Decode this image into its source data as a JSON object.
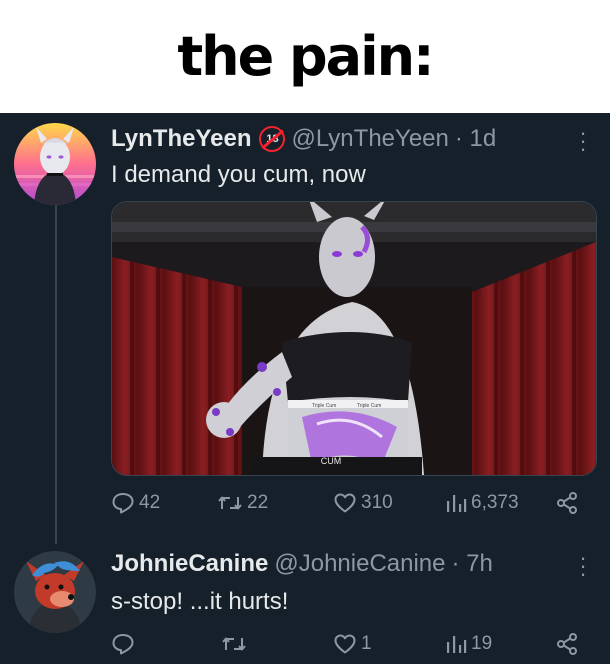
{
  "caption": {
    "text": "the pain:"
  },
  "tweets": [
    {
      "display_name": "LynTheYeen",
      "age_badge": "18",
      "handle": "@LynTheYeen",
      "time": "· 1d",
      "text": "I demand you cum, now",
      "media": {
        "label_words": [
          "Triple Cum",
          "Triple Cum",
          "CUM"
        ]
      },
      "metrics": {
        "replies": "42",
        "reposts": "22",
        "likes": "310",
        "views": "6,373"
      }
    },
    {
      "display_name": "JohnieCanine",
      "handle": "@JohnieCanine",
      "time": "· 7h",
      "text": "s-stop! ...it hurts!",
      "metrics": {
        "replies": "",
        "reposts": "",
        "likes": "1",
        "views": "19"
      }
    }
  ],
  "icons": {
    "reply": "speech-bubble-icon",
    "repost": "repost-arrows-icon",
    "like": "heart-icon",
    "views": "bar-chart-icon",
    "share": "share-icon",
    "more": "vertical-ellipsis-icon"
  },
  "colors": {
    "background": "#15202b",
    "caption_bg": "#ffffff",
    "text_primary": "#e7e9ea",
    "text_secondary": "#8b98a5",
    "thread_line": "#38444d",
    "adult_badge": "#f4212e"
  }
}
